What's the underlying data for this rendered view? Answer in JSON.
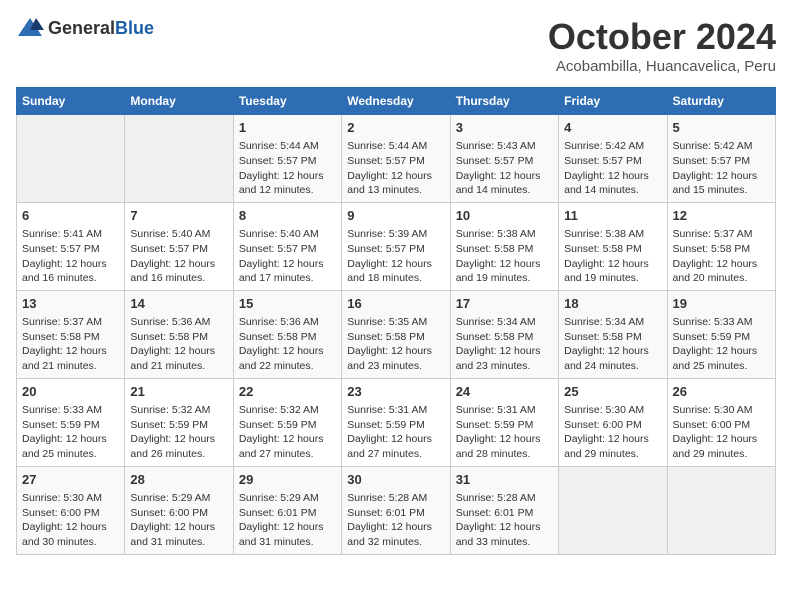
{
  "logo": {
    "general": "General",
    "blue": "Blue"
  },
  "title": "October 2024",
  "subtitle": "Acobambilla, Huancavelica, Peru",
  "days_of_week": [
    "Sunday",
    "Monday",
    "Tuesday",
    "Wednesday",
    "Thursday",
    "Friday",
    "Saturday"
  ],
  "weeks": [
    [
      {
        "day": "",
        "content": ""
      },
      {
        "day": "",
        "content": ""
      },
      {
        "day": "1",
        "content": "Sunrise: 5:44 AM\nSunset: 5:57 PM\nDaylight: 12 hours and 12 minutes."
      },
      {
        "day": "2",
        "content": "Sunrise: 5:44 AM\nSunset: 5:57 PM\nDaylight: 12 hours and 13 minutes."
      },
      {
        "day": "3",
        "content": "Sunrise: 5:43 AM\nSunset: 5:57 PM\nDaylight: 12 hours and 14 minutes."
      },
      {
        "day": "4",
        "content": "Sunrise: 5:42 AM\nSunset: 5:57 PM\nDaylight: 12 hours and 14 minutes."
      },
      {
        "day": "5",
        "content": "Sunrise: 5:42 AM\nSunset: 5:57 PM\nDaylight: 12 hours and 15 minutes."
      }
    ],
    [
      {
        "day": "6",
        "content": "Sunrise: 5:41 AM\nSunset: 5:57 PM\nDaylight: 12 hours and 16 minutes."
      },
      {
        "day": "7",
        "content": "Sunrise: 5:40 AM\nSunset: 5:57 PM\nDaylight: 12 hours and 16 minutes."
      },
      {
        "day": "8",
        "content": "Sunrise: 5:40 AM\nSunset: 5:57 PM\nDaylight: 12 hours and 17 minutes."
      },
      {
        "day": "9",
        "content": "Sunrise: 5:39 AM\nSunset: 5:57 PM\nDaylight: 12 hours and 18 minutes."
      },
      {
        "day": "10",
        "content": "Sunrise: 5:38 AM\nSunset: 5:58 PM\nDaylight: 12 hours and 19 minutes."
      },
      {
        "day": "11",
        "content": "Sunrise: 5:38 AM\nSunset: 5:58 PM\nDaylight: 12 hours and 19 minutes."
      },
      {
        "day": "12",
        "content": "Sunrise: 5:37 AM\nSunset: 5:58 PM\nDaylight: 12 hours and 20 minutes."
      }
    ],
    [
      {
        "day": "13",
        "content": "Sunrise: 5:37 AM\nSunset: 5:58 PM\nDaylight: 12 hours and 21 minutes."
      },
      {
        "day": "14",
        "content": "Sunrise: 5:36 AM\nSunset: 5:58 PM\nDaylight: 12 hours and 21 minutes."
      },
      {
        "day": "15",
        "content": "Sunrise: 5:36 AM\nSunset: 5:58 PM\nDaylight: 12 hours and 22 minutes."
      },
      {
        "day": "16",
        "content": "Sunrise: 5:35 AM\nSunset: 5:58 PM\nDaylight: 12 hours and 23 minutes."
      },
      {
        "day": "17",
        "content": "Sunrise: 5:34 AM\nSunset: 5:58 PM\nDaylight: 12 hours and 23 minutes."
      },
      {
        "day": "18",
        "content": "Sunrise: 5:34 AM\nSunset: 5:58 PM\nDaylight: 12 hours and 24 minutes."
      },
      {
        "day": "19",
        "content": "Sunrise: 5:33 AM\nSunset: 5:59 PM\nDaylight: 12 hours and 25 minutes."
      }
    ],
    [
      {
        "day": "20",
        "content": "Sunrise: 5:33 AM\nSunset: 5:59 PM\nDaylight: 12 hours and 25 minutes."
      },
      {
        "day": "21",
        "content": "Sunrise: 5:32 AM\nSunset: 5:59 PM\nDaylight: 12 hours and 26 minutes."
      },
      {
        "day": "22",
        "content": "Sunrise: 5:32 AM\nSunset: 5:59 PM\nDaylight: 12 hours and 27 minutes."
      },
      {
        "day": "23",
        "content": "Sunrise: 5:31 AM\nSunset: 5:59 PM\nDaylight: 12 hours and 27 minutes."
      },
      {
        "day": "24",
        "content": "Sunrise: 5:31 AM\nSunset: 5:59 PM\nDaylight: 12 hours and 28 minutes."
      },
      {
        "day": "25",
        "content": "Sunrise: 5:30 AM\nSunset: 6:00 PM\nDaylight: 12 hours and 29 minutes."
      },
      {
        "day": "26",
        "content": "Sunrise: 5:30 AM\nSunset: 6:00 PM\nDaylight: 12 hours and 29 minutes."
      }
    ],
    [
      {
        "day": "27",
        "content": "Sunrise: 5:30 AM\nSunset: 6:00 PM\nDaylight: 12 hours and 30 minutes."
      },
      {
        "day": "28",
        "content": "Sunrise: 5:29 AM\nSunset: 6:00 PM\nDaylight: 12 hours and 31 minutes."
      },
      {
        "day": "29",
        "content": "Sunrise: 5:29 AM\nSunset: 6:01 PM\nDaylight: 12 hours and 31 minutes."
      },
      {
        "day": "30",
        "content": "Sunrise: 5:28 AM\nSunset: 6:01 PM\nDaylight: 12 hours and 32 minutes."
      },
      {
        "day": "31",
        "content": "Sunrise: 5:28 AM\nSunset: 6:01 PM\nDaylight: 12 hours and 33 minutes."
      },
      {
        "day": "",
        "content": ""
      },
      {
        "day": "",
        "content": ""
      }
    ]
  ]
}
